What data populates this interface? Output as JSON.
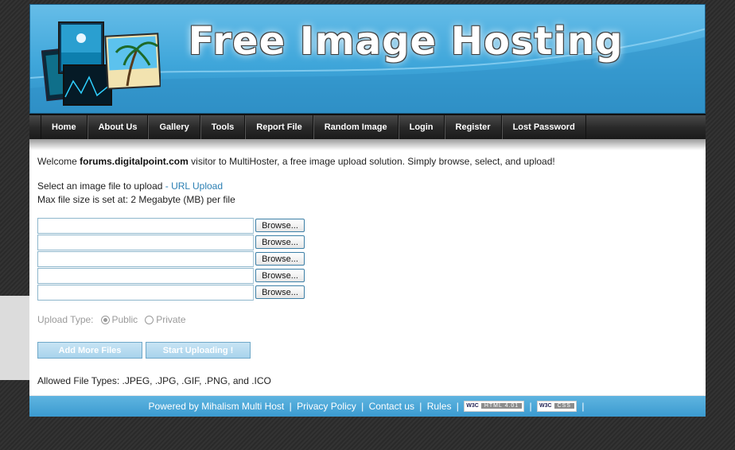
{
  "header": {
    "title": "Free Image Hosting"
  },
  "nav": {
    "items": [
      "Home",
      "About Us",
      "Gallery",
      "Tools",
      "Report File",
      "Random Image",
      "Login",
      "Register",
      "Lost Password"
    ]
  },
  "content": {
    "welcome_prefix": "Welcome ",
    "welcome_host": "forums.digitalpoint.com",
    "welcome_suffix": " visitor to MultiHoster, a free image upload solution. Simply browse, select, and upload!",
    "select_text": "Select an image file to upload",
    "url_upload_link": " - URL Upload",
    "max_size_text": "Max file size is set at: 2 Megabyte (MB) per file",
    "browse_label": "Browse...",
    "upload_type_label": "Upload Type:",
    "public_label": "Public",
    "private_label": "Private",
    "add_more_button": "Add More Files",
    "start_upload_button": "Start Uploading !",
    "allowed_types": "Allowed File Types: .JPEG, .JPG, .GIF, .PNG, and .ICO"
  },
  "footer": {
    "powered_by": "Powered by Mihalism Multi Host",
    "privacy": "Privacy Policy",
    "contact": "Contact us",
    "rules": "Rules",
    "badge_w3c": "W3C",
    "badge_html": "HTML 4.01",
    "badge_css": "CSS",
    "separator": "|"
  },
  "colors": {
    "header_blue": "#3fa6da",
    "link_blue": "#2b7fb3",
    "nav_dark": "#2a2a2a"
  }
}
